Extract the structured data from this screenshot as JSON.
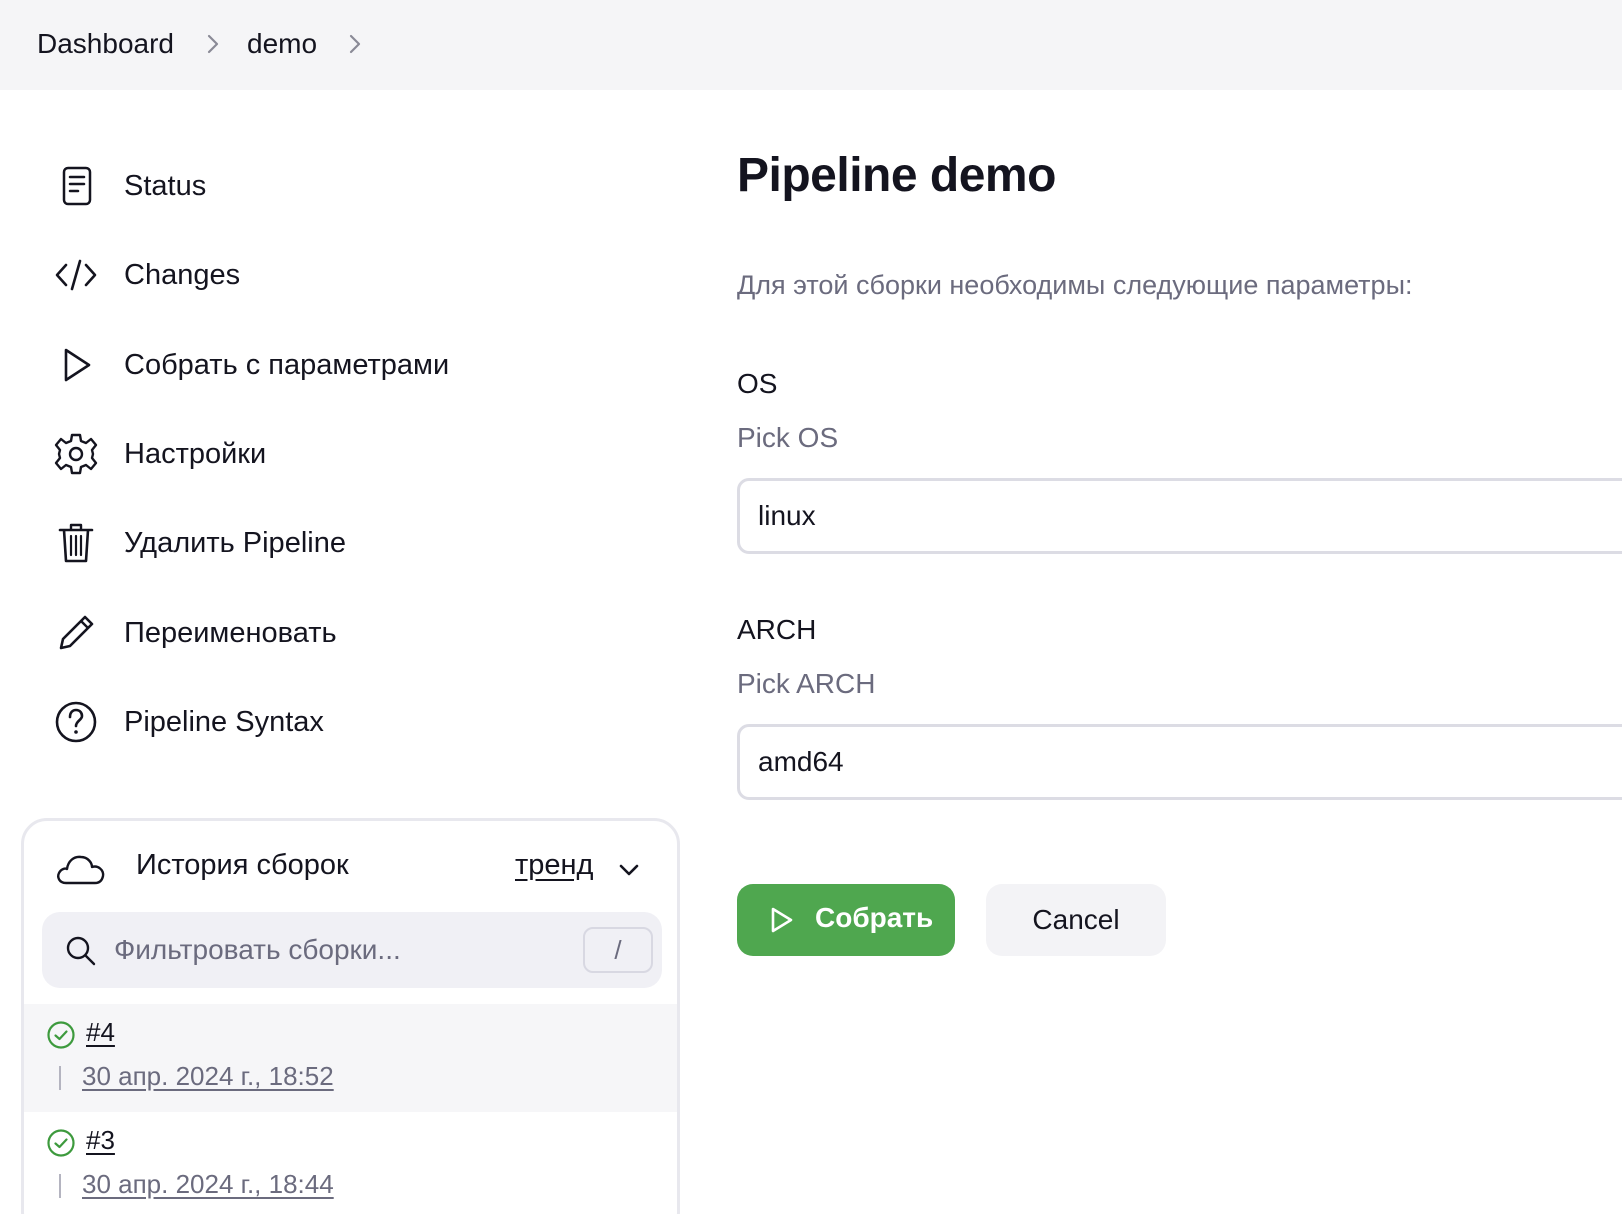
{
  "breadcrumb": {
    "items": [
      "Dashboard",
      "demo"
    ]
  },
  "sidebar": {
    "items": [
      {
        "label": "Status",
        "icon": "document-icon"
      },
      {
        "label": "Changes",
        "icon": "code-icon"
      },
      {
        "label": "Собрать с параметрами",
        "icon": "play-icon"
      },
      {
        "label": "Настройки",
        "icon": "gear-icon"
      },
      {
        "label": "Удалить Pipeline",
        "icon": "trash-icon"
      },
      {
        "label": "Переименовать",
        "icon": "pencil-icon"
      },
      {
        "label": "Pipeline Syntax",
        "icon": "help-icon"
      }
    ]
  },
  "build_history": {
    "title": "История сборок",
    "trend_label": "тренд",
    "search_placeholder": "Фильтровать сборки...",
    "shortcut": "/",
    "builds": [
      {
        "number": "#4",
        "date": "30 апр. 2024 г., 18:52",
        "status": "success"
      },
      {
        "number": "#3",
        "date": "30 апр. 2024 г., 18:44",
        "status": "success"
      }
    ]
  },
  "main": {
    "title": "Pipeline demo",
    "description": "Для этой сборки необходимы следующие параметры:",
    "params": [
      {
        "name": "OS",
        "description": "Pick OS",
        "value": "linux"
      },
      {
        "name": "ARCH",
        "description": "Pick ARCH",
        "value": "amd64"
      }
    ],
    "build_button": "Собрать",
    "cancel_button": "Cancel"
  },
  "colors": {
    "accent_green": "#4fa74f",
    "muted_text": "#6b6b7e",
    "topbar_bg": "#f5f5f7"
  }
}
